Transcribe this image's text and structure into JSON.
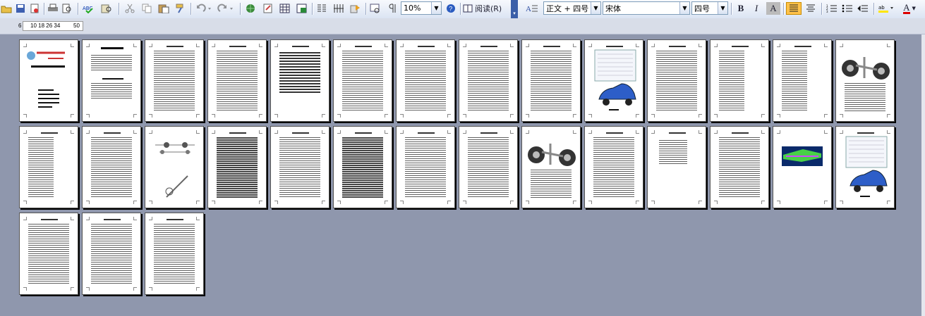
{
  "toolbar": {
    "zoom": "10%",
    "read_label": "阅读(R)",
    "style_value": "正文 + 四号",
    "font_value": "宋体",
    "size_value": "四号",
    "bold": "B",
    "italic": "I",
    "highlight": "A",
    "font_color": "A"
  },
  "ruler": {
    "scale_text": "10 18 26 34",
    "left_num": "6",
    "right_num": "50"
  },
  "colors": {
    "background": "#8f97ad",
    "toolbar_active": "#ffc24a"
  },
  "page_types": [
    "cover",
    "toc",
    "text",
    "dense",
    "table",
    "text",
    "text",
    "text",
    "text-figure",
    "car-figure",
    "text",
    "list",
    "text-list",
    "suspension-figure",
    "list",
    "text",
    "diagram",
    "text-bold",
    "text",
    "text-bold",
    "text",
    "text",
    "suspension-figure",
    "text",
    "formula",
    "text",
    "beam-figure",
    "car-top-figure",
    "text",
    "text",
    "text"
  ]
}
